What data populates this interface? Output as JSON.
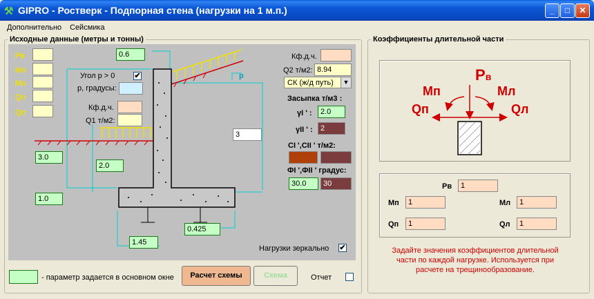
{
  "window": {
    "title": "GIPRO - Ростверк - Подпорная стена (нагрузки на 1 м.п.)"
  },
  "menu": {
    "items": [
      "Дополнительно",
      "Сейсмика"
    ]
  },
  "left_panel": {
    "legend": "Исходные данные (метры и тонны)",
    "load_labels": [
      "Рв",
      "Мп",
      "Мл",
      "Qп",
      "Qп"
    ],
    "top_width": "0.6",
    "angle_label": "Угол р > 0",
    "angle_checked": "✔",
    "angle_deg_label": "р, градусы:",
    "p_label": "р",
    "kfdch_label": "Кф.д.ч.",
    "q1_label": "Q1 т/м2:",
    "left_height": "3.0",
    "inner_height": "2.0",
    "footing_height": "1.0",
    "right_height": "3",
    "footing_thickness": "0.425",
    "footing_left": "1.45",
    "right_kfdch_label": "Кф.д.ч.",
    "q2_label": "Q2 т/м2:",
    "q2_value": "8.94",
    "load_type": "СК (ж/д путь)",
    "fill_label": "Засыпка т/м3 :",
    "y1_label": "γI ' :",
    "y1_value": "2.0",
    "y2_label": "γII ' :",
    "y2_value": "2",
    "c_label": "CI ',CII ' т/м2:",
    "phi_label": "ФI ',ФII ' градус:",
    "phi1": "30.0",
    "phi2": "30",
    "mirror_label": "Нагрузки зеркально",
    "mirror_checked": "✔"
  },
  "bottom": {
    "legend_text": "- параметр задается в основном окне",
    "calc_button": "Расчет схемы",
    "scheme_button": "Схема",
    "report_label": "Отчет"
  },
  "right_panel": {
    "legend": "Коэффициенты длительной части",
    "diagram": {
      "pv": "P",
      "pv_sub": "в",
      "mp": "Mп",
      "ml": "Mл",
      "qp": "Qп",
      "ql": "Qл"
    },
    "pv_label": "Рв",
    "pv_value": "1",
    "mp_label": "Мп",
    "mp_value": "1",
    "ml_label": "Мл",
    "ml_value": "1",
    "qp_label": "Qп",
    "qp_value": "1",
    "ql_label": "Qл",
    "ql_value": "1",
    "note": "Задайте значения коэффициентов длительной части по каждой нагрузке. Используется при расчете на трещинообразование."
  },
  "colors": {
    "title_blue": "#0b56d4",
    "canvas_gray": "#c0c0c0",
    "load_yellow": "#f0e000",
    "dim_cyan": "#00d0d0",
    "red": "#d00000"
  }
}
